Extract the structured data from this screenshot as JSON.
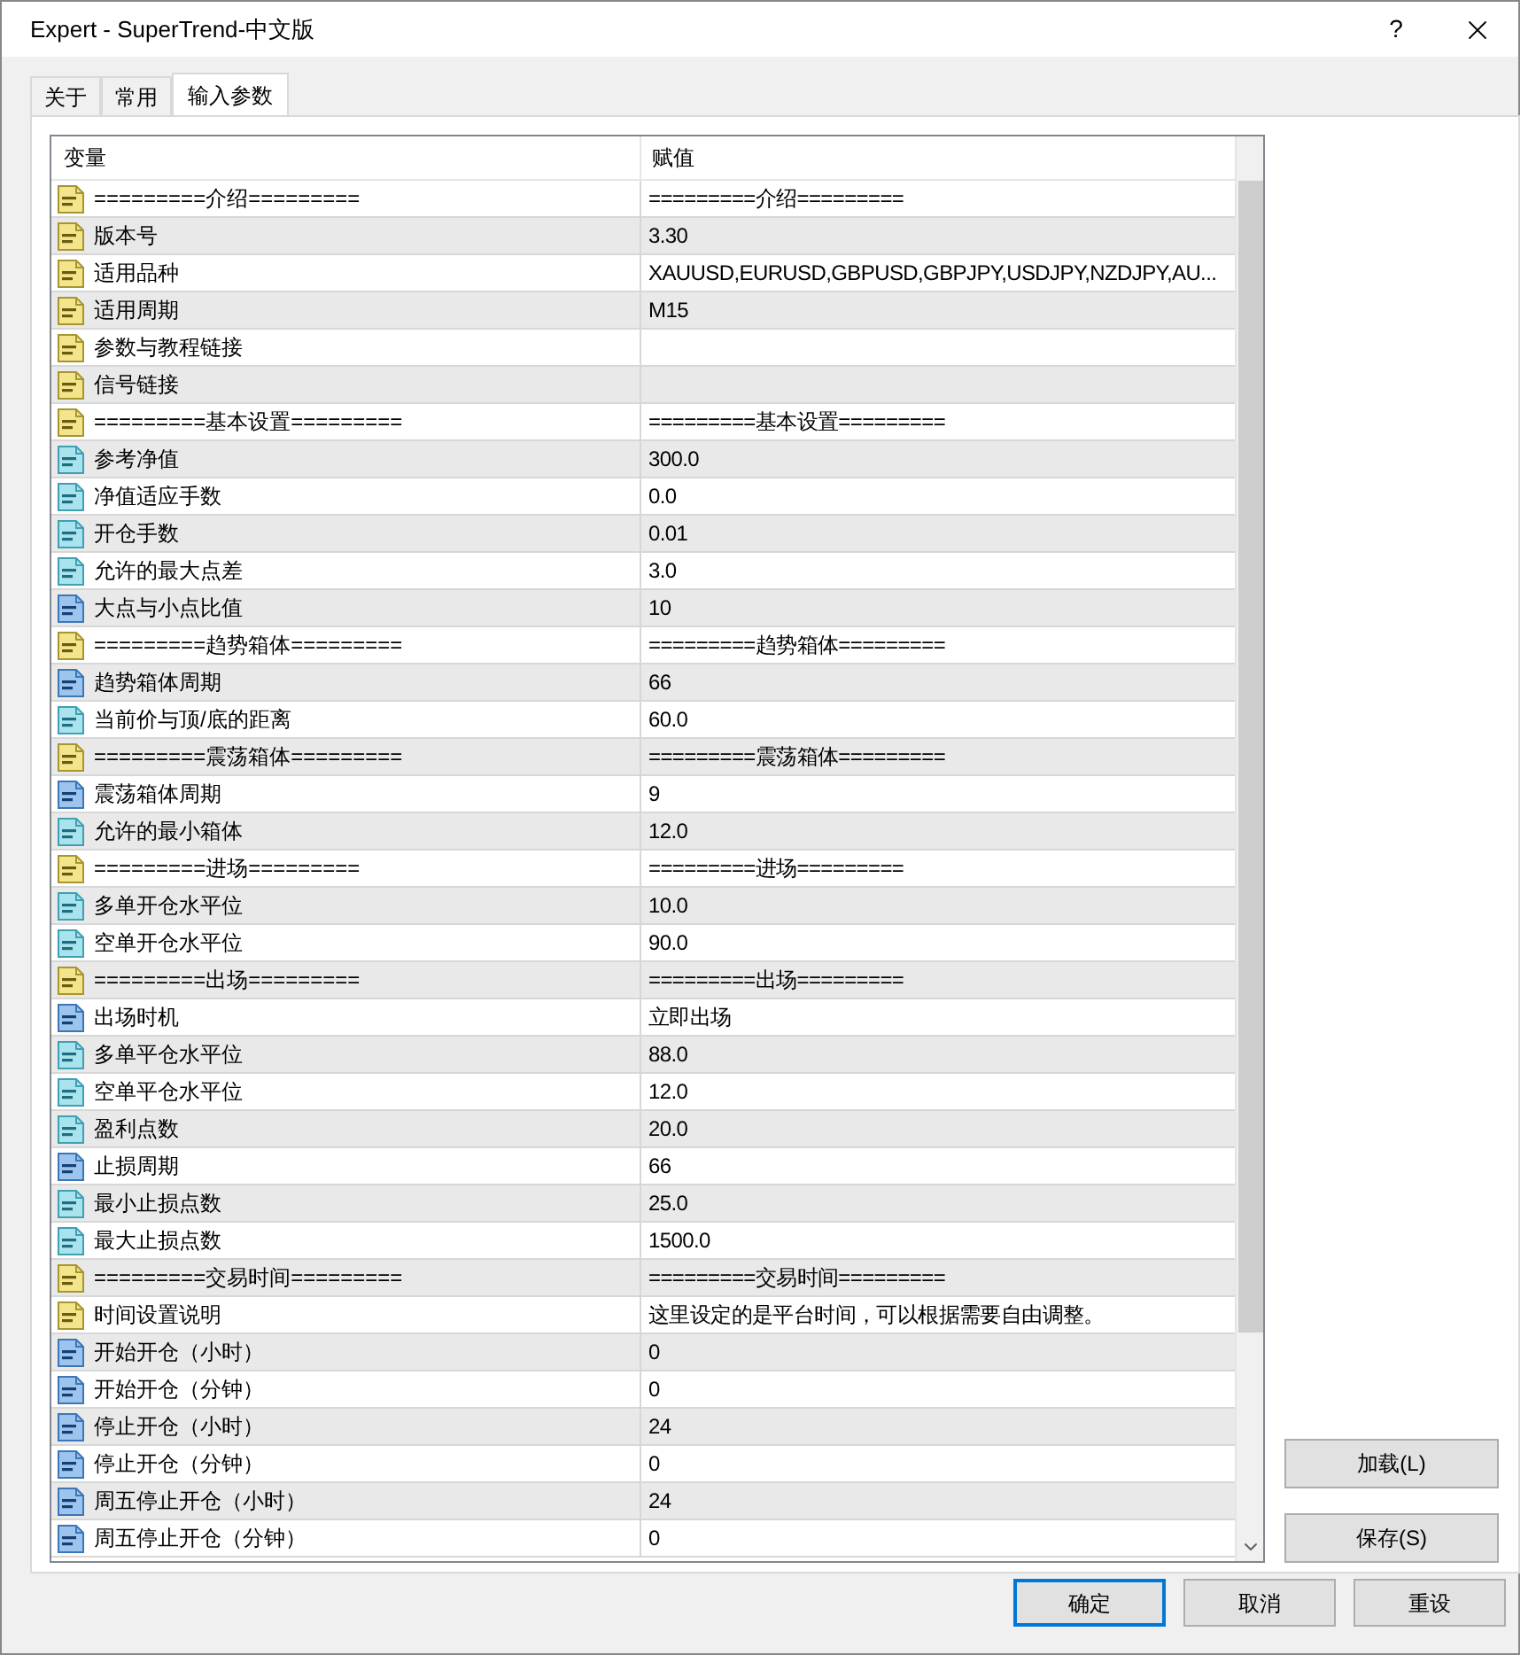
{
  "window": {
    "title": "Expert - SuperTrend-中文版",
    "help": "?"
  },
  "tabs": [
    {
      "label": "关于",
      "selected": false
    },
    {
      "label": "常用",
      "selected": false
    },
    {
      "label": "输入参数",
      "selected": true
    }
  ],
  "table": {
    "columns": [
      "变量",
      "赋值"
    ],
    "rows": [
      {
        "kind": "string",
        "name": "=========介绍=========",
        "value": "=========介绍========="
      },
      {
        "kind": "string",
        "name": "版本号",
        "value": "3.30"
      },
      {
        "kind": "string",
        "name": "适用品种",
        "value": "XAUUSD,EURUSD,GBPUSD,GBPJPY,USDJPY,NZDJPY,AU..."
      },
      {
        "kind": "string",
        "name": "适用周期",
        "value": "M15"
      },
      {
        "kind": "string",
        "name": "参数与教程链接"
      },
      {
        "kind": "string",
        "name": "信号链接"
      },
      {
        "kind": "string",
        "name": "=========基本设置=========",
        "value": "=========基本设置========="
      },
      {
        "kind": "double",
        "name": "参考净值",
        "value": "300.0"
      },
      {
        "kind": "double",
        "name": "净值适应手数",
        "value": "0.0"
      },
      {
        "kind": "double",
        "name": "开仓手数",
        "value": "0.01"
      },
      {
        "kind": "double",
        "name": "允许的最大点差",
        "value": "3.0"
      },
      {
        "kind": "int",
        "name": "大点与小点比值",
        "value": "10"
      },
      {
        "kind": "string",
        "name": "=========趋势箱体=========",
        "value": "=========趋势箱体========="
      },
      {
        "kind": "int",
        "name": "趋势箱体周期",
        "value": "66"
      },
      {
        "kind": "double",
        "name": "当前价与顶/底的距离",
        "value": "60.0"
      },
      {
        "kind": "string",
        "name": "=========震荡箱体=========",
        "value": "=========震荡箱体========="
      },
      {
        "kind": "int",
        "name": "震荡箱体周期",
        "value": "9"
      },
      {
        "kind": "double",
        "name": "允许的最小箱体",
        "value": "12.0"
      },
      {
        "kind": "string",
        "name": "=========进场=========",
        "value": "=========进场========="
      },
      {
        "kind": "double",
        "name": "多单开仓水平位",
        "value": "10.0"
      },
      {
        "kind": "double",
        "name": "空单开仓水平位",
        "value": "90.0"
      },
      {
        "kind": "string",
        "name": "=========出场=========",
        "value": "=========出场========="
      },
      {
        "kind": "int",
        "name": "出场时机",
        "value": "立即出场"
      },
      {
        "kind": "double",
        "name": "多单平仓水平位",
        "value": "88.0"
      },
      {
        "kind": "double",
        "name": "空单平仓水平位",
        "value": "12.0"
      },
      {
        "kind": "double",
        "name": "盈利点数",
        "value": "20.0"
      },
      {
        "kind": "int",
        "name": "止损周期",
        "value": "66"
      },
      {
        "kind": "double",
        "name": "最小止损点数",
        "value": "25.0"
      },
      {
        "kind": "double",
        "name": "最大止损点数",
        "value": "1500.0"
      },
      {
        "kind": "string",
        "name": "=========交易时间=========",
        "value": "=========交易时间========="
      },
      {
        "kind": "string",
        "name": "时间设置说明",
        "value": "这里设定的是平台时间，可以根据需要自由调整。"
      },
      {
        "kind": "int",
        "name": "开始开仓（小时）",
        "value": "0"
      },
      {
        "kind": "int",
        "name": "开始开仓（分钟）",
        "value": "0"
      },
      {
        "kind": "int",
        "name": "停止开仓（小时）",
        "value": "24"
      },
      {
        "kind": "int",
        "name": "停止开仓（分钟）",
        "value": "0"
      },
      {
        "kind": "int",
        "name": "周五停止开仓（小时）",
        "value": "24"
      },
      {
        "kind": "int",
        "name": "周五停止开仓（分钟）",
        "value": "0"
      }
    ]
  },
  "side_buttons": [
    "加载(L)",
    "保存(S)"
  ],
  "buttons": [
    {
      "label": "确定",
      "selected": true
    },
    {
      "label": "取消",
      "selected": false
    },
    {
      "label": "重设",
      "selected": false
    }
  ]
}
